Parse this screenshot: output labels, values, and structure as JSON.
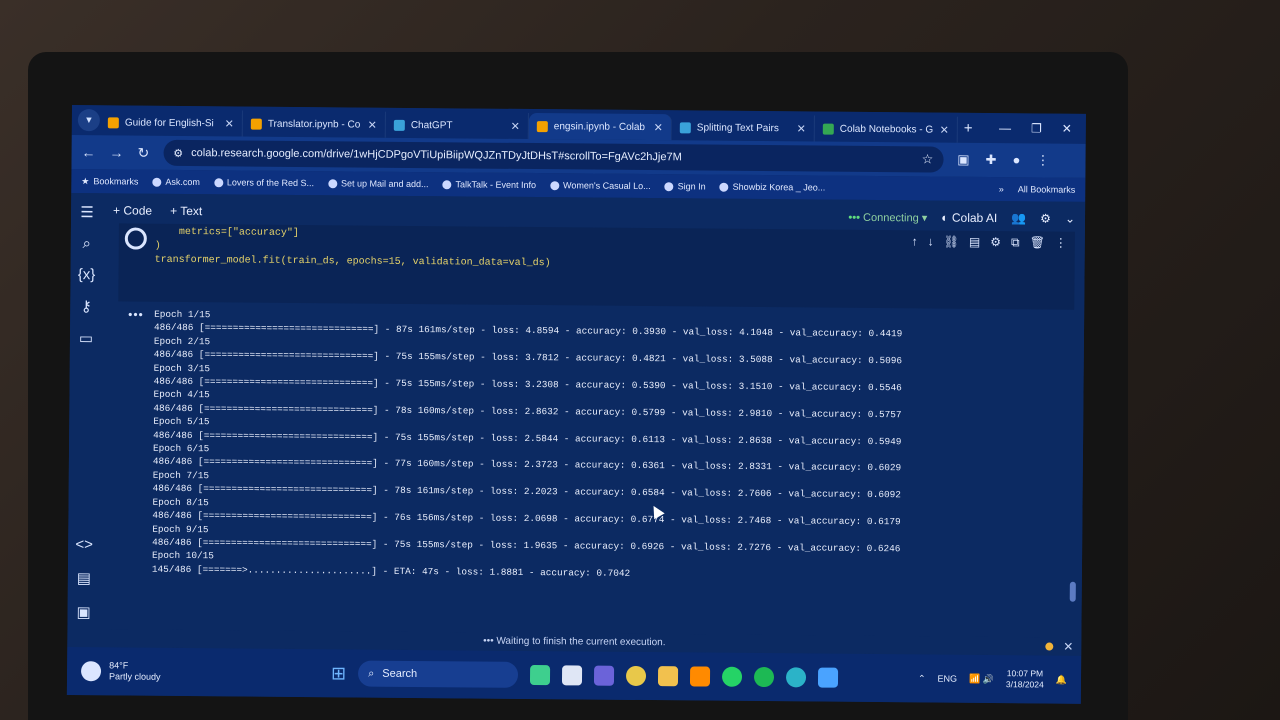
{
  "browser": {
    "tabs": [
      {
        "title": "Guide for English-Si",
        "active": false
      },
      {
        "title": "Translator.ipynb - Co",
        "active": false
      },
      {
        "title": "ChatGPT",
        "active": false
      },
      {
        "title": "engsin.ipynb - Colab",
        "active": true
      },
      {
        "title": "Splitting Text Pairs",
        "active": false
      },
      {
        "title": "Colab Notebooks - G",
        "active": false
      }
    ],
    "url": "colab.research.google.com/drive/1wHjCDPgoVTiUpiBiipWQJZnTDyJtDHsT#scrollTo=FgAVc2hJje7M",
    "bookmarks": [
      "Bookmarks",
      "Ask.com",
      "Lovers of the Red S...",
      "Set up Mail and add...",
      "TalkTalk - Event Info",
      "Women's Casual Lo...",
      "Sign In",
      "Showbiz Korea _ Jeo..."
    ],
    "all_bookmarks": "All Bookmarks"
  },
  "colab": {
    "add_code": "+ Code",
    "add_text": "+ Text",
    "status": "Connecting",
    "ai": "Colab AI",
    "code_lines": [
      "    metrics=[\"accuracy\"]",
      ")",
      "",
      "transformer_model.fit(train_ds, epochs=15, validation_data=val_ds)"
    ],
    "output_lines": [
      "Epoch 1/15",
      "486/486 [==============================] - 87s 161ms/step - loss: 4.8594 - accuracy: 0.3930 - val_loss: 4.1048 - val_accuracy: 0.4419",
      "Epoch 2/15",
      "486/486 [==============================] - 75s 155ms/step - loss: 3.7812 - accuracy: 0.4821 - val_loss: 3.5088 - val_accuracy: 0.5096",
      "Epoch 3/15",
      "486/486 [==============================] - 75s 155ms/step - loss: 3.2308 - accuracy: 0.5390 - val_loss: 3.1510 - val_accuracy: 0.5546",
      "Epoch 4/15",
      "486/486 [==============================] - 78s 160ms/step - loss: 2.8632 - accuracy: 0.5799 - val_loss: 2.9810 - val_accuracy: 0.5757",
      "Epoch 5/15",
      "486/486 [==============================] - 75s 155ms/step - loss: 2.5844 - accuracy: 0.6113 - val_loss: 2.8638 - val_accuracy: 0.5949",
      "Epoch 6/15",
      "486/486 [==============================] - 77s 160ms/step - loss: 2.3723 - accuracy: 0.6361 - val_loss: 2.8331 - val_accuracy: 0.6029",
      "Epoch 7/15",
      "486/486 [==============================] - 78s 161ms/step - loss: 2.2023 - accuracy: 0.6584 - val_loss: 2.7606 - val_accuracy: 0.6092",
      "Epoch 8/15",
      "486/486 [==============================] - 76s 156ms/step - loss: 2.0698 - accuracy: 0.6774 - val_loss: 2.7468 - val_accuracy: 0.6179",
      "Epoch 9/15",
      "486/486 [==============================] - 75s 155ms/step - loss: 1.9635 - accuracy: 0.6926 - val_loss: 2.7276 - val_accuracy: 0.6246",
      "Epoch 10/15",
      "145/486 [=======>......................] - ETA: 47s - loss: 1.8881 - accuracy: 0.7042"
    ],
    "statusbar": "Waiting to finish the current execution."
  },
  "taskbar": {
    "temp": "84°F",
    "weather": "Partly cloudy",
    "search": "Search",
    "lang": "ENG",
    "time": "10:07 PM",
    "date": "3/18/2024"
  }
}
